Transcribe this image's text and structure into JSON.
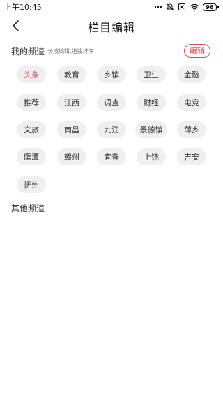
{
  "status_bar": {
    "time": "上午10:45",
    "battery_level": "96",
    "icons": [
      "dots-icon",
      "mute-icon",
      "no-sim-icon",
      "wifi-icon",
      "battery-icon"
    ]
  },
  "nav": {
    "title": "栏目编辑",
    "back_icon": "chevron-left-icon"
  },
  "my_channels": {
    "title": "我的频道",
    "hint": "长按编辑,拖拽排序",
    "edit_label": "编辑",
    "active_index": 0,
    "items": [
      "头条",
      "教育",
      "乡镇",
      "卫生",
      "金融",
      "推荐",
      "江西",
      "调查",
      "财经",
      "电竞",
      "文旅",
      "南昌",
      "九江",
      "景德镇",
      "萍乡",
      "鹰潭",
      "赣州",
      "宜春",
      "上饶",
      "吉安",
      "抚州"
    ]
  },
  "other_channels": {
    "title": "其他频道"
  },
  "colors": {
    "accent": "#d94a52",
    "chip_bg": "#efeff0",
    "text": "#333333"
  }
}
